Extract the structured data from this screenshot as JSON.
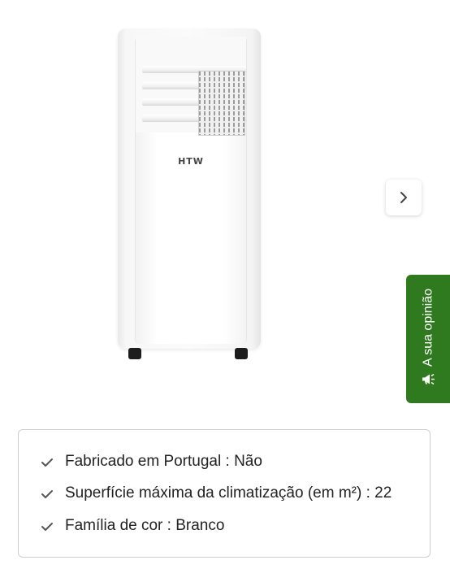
{
  "product": {
    "brand": "HTW",
    "image_alt": "Ar condicionado portátil HTW branco"
  },
  "gallery": {
    "next_icon": "chevron-right-icon"
  },
  "feedback": {
    "label": "A sua opinião",
    "icon": "megaphone-icon",
    "color": "#2f7a1f"
  },
  "specs": [
    {
      "label": "Fabricado em Portugal",
      "separator": " : ",
      "value": "Não"
    },
    {
      "label": "Superfície máxima da climatização (em m²)",
      "separator": " : ",
      "value": "22"
    },
    {
      "label": "Família de cor",
      "separator": " : ",
      "value": "Branco"
    }
  ]
}
